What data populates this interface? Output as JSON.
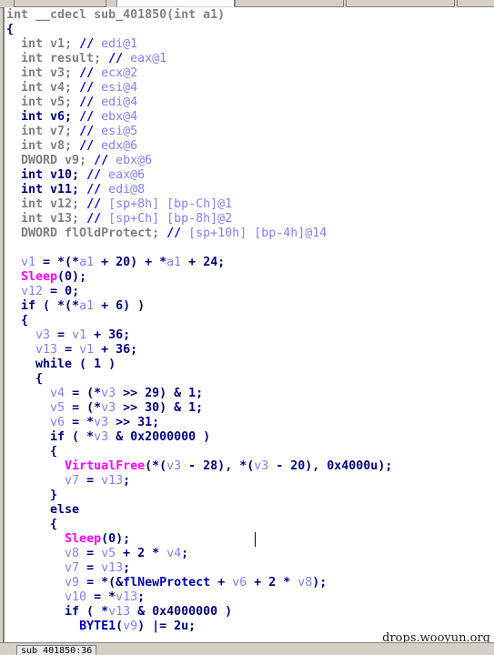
{
  "window": {
    "status_tab": "sub_401850:36",
    "watermark": "drops.wooyun.org"
  },
  "colors": {
    "declaration": "#808080",
    "keyword": "#000080",
    "comment": "#8080ff",
    "variable": "#8080ff",
    "function": "#ff00ff"
  },
  "code": [
    [
      [
        "g",
        "int __cdecl sub_401850(int a1)"
      ]
    ],
    [
      [
        "n",
        "{"
      ]
    ],
    [
      [
        "g",
        "  int v1; "
      ],
      [
        "s",
        "// "
      ],
      [
        "c",
        "edi@1"
      ]
    ],
    [
      [
        "g",
        "  int result; "
      ],
      [
        "s",
        "// "
      ],
      [
        "c",
        "eax@1"
      ]
    ],
    [
      [
        "g",
        "  int v3; "
      ],
      [
        "s",
        "// "
      ],
      [
        "c",
        "ecx@2"
      ]
    ],
    [
      [
        "g",
        "  int v4; "
      ],
      [
        "s",
        "// "
      ],
      [
        "c",
        "esi@4"
      ]
    ],
    [
      [
        "g",
        "  int v5; "
      ],
      [
        "s",
        "// "
      ],
      [
        "c",
        "edi@4"
      ]
    ],
    [
      [
        "n",
        "  int v6; "
      ],
      [
        "s",
        "// "
      ],
      [
        "c",
        "ebx@4"
      ]
    ],
    [
      [
        "g",
        "  int v7; "
      ],
      [
        "s",
        "// "
      ],
      [
        "c",
        "esi@5"
      ]
    ],
    [
      [
        "g",
        "  int v8; "
      ],
      [
        "s",
        "// "
      ],
      [
        "c",
        "edx@6"
      ]
    ],
    [
      [
        "g",
        "  DWORD v9; "
      ],
      [
        "s",
        "// "
      ],
      [
        "c",
        "ebx@6"
      ]
    ],
    [
      [
        "n",
        "  int v10; "
      ],
      [
        "s",
        "// "
      ],
      [
        "c",
        "eax@6"
      ]
    ],
    [
      [
        "n",
        "  int v11; "
      ],
      [
        "s",
        "// "
      ],
      [
        "c",
        "edi@8"
      ]
    ],
    [
      [
        "g",
        "  int v12; "
      ],
      [
        "s",
        "// "
      ],
      [
        "c",
        "[sp+8h] [bp-Ch]@1"
      ]
    ],
    [
      [
        "g",
        "  int v13; "
      ],
      [
        "s",
        "// "
      ],
      [
        "c",
        "[sp+Ch] [bp-8h]@2"
      ]
    ],
    [
      [
        "g",
        "  DWORD flOldProtect; "
      ],
      [
        "s",
        "// "
      ],
      [
        "c",
        "[sp+10h] [bp-4h]@14"
      ]
    ],
    [
      [
        "n",
        " "
      ]
    ],
    [
      [
        "n",
        "  "
      ],
      [
        "v",
        "v1"
      ],
      [
        "n",
        " = *(*"
      ],
      [
        "v",
        "a1"
      ],
      [
        "n",
        " + 20) + *"
      ],
      [
        "v",
        "a1"
      ],
      [
        "n",
        " + 24;"
      ]
    ],
    [
      [
        "n",
        "  "
      ],
      [
        "f",
        "Sleep"
      ],
      [
        "n",
        "(0);"
      ]
    ],
    [
      [
        "n",
        "  "
      ],
      [
        "v",
        "v12"
      ],
      [
        "n",
        " = 0;"
      ]
    ],
    [
      [
        "n",
        "  if ( *(*"
      ],
      [
        "v",
        "a1"
      ],
      [
        "n",
        " + 6) )"
      ]
    ],
    [
      [
        "n",
        "  {"
      ]
    ],
    [
      [
        "n",
        "    "
      ],
      [
        "v",
        "v3"
      ],
      [
        "n",
        " = "
      ],
      [
        "v",
        "v1"
      ],
      [
        "n",
        " + 36;"
      ]
    ],
    [
      [
        "n",
        "    "
      ],
      [
        "v",
        "v13"
      ],
      [
        "n",
        " = "
      ],
      [
        "v",
        "v1"
      ],
      [
        "n",
        " + 36;"
      ]
    ],
    [
      [
        "n",
        "    while ( 1 )"
      ]
    ],
    [
      [
        "n",
        "    {"
      ]
    ],
    [
      [
        "n",
        "      "
      ],
      [
        "v",
        "v4"
      ],
      [
        "n",
        " = (*"
      ],
      [
        "v",
        "v3"
      ],
      [
        "n",
        " >> 29) & 1;"
      ]
    ],
    [
      [
        "n",
        "      "
      ],
      [
        "v",
        "v5"
      ],
      [
        "n",
        " = (*"
      ],
      [
        "v",
        "v3"
      ],
      [
        "n",
        " >> 30) & 1;"
      ]
    ],
    [
      [
        "n",
        "      "
      ],
      [
        "v",
        "v6"
      ],
      [
        "n",
        " = *"
      ],
      [
        "v",
        "v3"
      ],
      [
        "n",
        " >> 31;"
      ]
    ],
    [
      [
        "n",
        "      if ( *"
      ],
      [
        "v",
        "v3"
      ],
      [
        "n",
        " & 0x2000000 )"
      ]
    ],
    [
      [
        "n",
        "      {"
      ]
    ],
    [
      [
        "n",
        "        "
      ],
      [
        "f",
        "VirtualFree"
      ],
      [
        "n",
        "(*("
      ],
      [
        "v",
        "v3"
      ],
      [
        "n",
        " - 28), *("
      ],
      [
        "v",
        "v3"
      ],
      [
        "n",
        " - 20), 0x4000u);"
      ]
    ],
    [
      [
        "n",
        "        "
      ],
      [
        "v",
        "v7"
      ],
      [
        "n",
        " = "
      ],
      [
        "v",
        "v13"
      ],
      [
        "n",
        ";"
      ]
    ],
    [
      [
        "n",
        "      }"
      ]
    ],
    [
      [
        "n",
        "      else"
      ]
    ],
    [
      [
        "n",
        "      {"
      ]
    ],
    [
      [
        "n",
        "        "
      ],
      [
        "f",
        "Sleep"
      ],
      [
        "n",
        "(0);"
      ]
    ],
    [
      [
        "n",
        "        "
      ],
      [
        "v",
        "v8"
      ],
      [
        "n",
        " = "
      ],
      [
        "v",
        "v5"
      ],
      [
        "n",
        " + 2 * "
      ],
      [
        "v",
        "v4"
      ],
      [
        "n",
        ";"
      ]
    ],
    [
      [
        "n",
        "        "
      ],
      [
        "v",
        "v7"
      ],
      [
        "n",
        " = "
      ],
      [
        "v",
        "v13"
      ],
      [
        "n",
        ";"
      ]
    ],
    [
      [
        "n",
        "        "
      ],
      [
        "v",
        "v9"
      ],
      [
        "n",
        " = *(&"
      ],
      [
        "b",
        "flNewProtect"
      ],
      [
        "n",
        " + "
      ],
      [
        "v",
        "v6"
      ],
      [
        "n",
        " + 2 * "
      ],
      [
        "v",
        "v8"
      ],
      [
        "n",
        ");"
      ]
    ],
    [
      [
        "n",
        "        "
      ],
      [
        "v",
        "v10"
      ],
      [
        "n",
        " = *"
      ],
      [
        "v",
        "v13"
      ],
      [
        "n",
        ";"
      ]
    ],
    [
      [
        "n",
        "        if ( *"
      ],
      [
        "v",
        "v13"
      ],
      [
        "n",
        " & 0x4000000 )"
      ]
    ],
    [
      [
        "n",
        "          "
      ],
      [
        "b",
        "BYTE1"
      ],
      [
        "n",
        "("
      ],
      [
        "v",
        "v9"
      ],
      [
        "n",
        ") |= 2u;"
      ]
    ]
  ]
}
